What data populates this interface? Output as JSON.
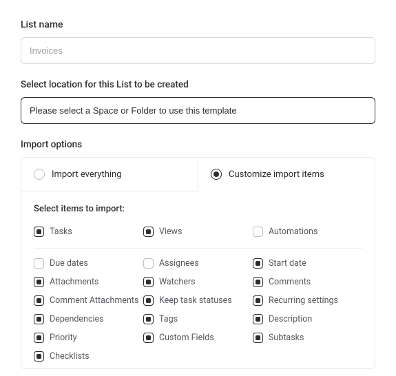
{
  "list_name": {
    "label": "List name",
    "value": "Invoices"
  },
  "location": {
    "label": "Select location for this List to be created",
    "value": "Please select a Space or Folder to use this template"
  },
  "import_options": {
    "label": "Import options",
    "tabs": [
      {
        "label": "Import everything",
        "active": false
      },
      {
        "label": "Customize import items",
        "active": true
      }
    ],
    "subtitle": "Select items to import:",
    "top_items": [
      {
        "label": "Tasks",
        "checked": true
      },
      {
        "label": "Views",
        "checked": true
      },
      {
        "label": "Automations",
        "checked": false
      }
    ],
    "grid_items": [
      {
        "label": "Due dates",
        "checked": false
      },
      {
        "label": "Assignees",
        "checked": false
      },
      {
        "label": "Start date",
        "checked": true
      },
      {
        "label": "Attachments",
        "checked": true
      },
      {
        "label": "Watchers",
        "checked": true
      },
      {
        "label": "Comments",
        "checked": true
      },
      {
        "label": "Comment Attachments",
        "checked": true
      },
      {
        "label": "Keep task statuses",
        "checked": true
      },
      {
        "label": "Recurring settings",
        "checked": true
      },
      {
        "label": "Dependencies",
        "checked": true
      },
      {
        "label": "Tags",
        "checked": true
      },
      {
        "label": "Description",
        "checked": true
      },
      {
        "label": "Priority",
        "checked": true
      },
      {
        "label": "Custom Fields",
        "checked": true
      },
      {
        "label": "Subtasks",
        "checked": true
      },
      {
        "label": "Checklists",
        "checked": true
      }
    ]
  }
}
